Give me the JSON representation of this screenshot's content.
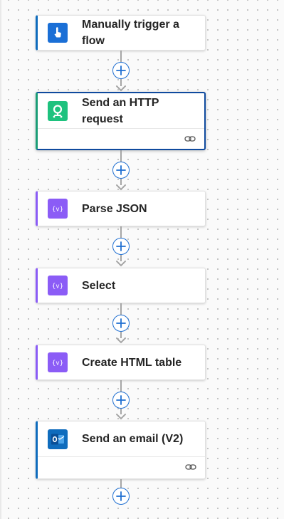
{
  "steps": [
    {
      "title": "Manually trigger a flow",
      "icon": "hand-touch-icon"
    },
    {
      "title": "Send an HTTP request",
      "icon": "http-connector-icon"
    },
    {
      "title": "Parse JSON",
      "icon": "data-operation-icon"
    },
    {
      "title": "Select",
      "icon": "data-operation-icon"
    },
    {
      "title": "Create HTML table",
      "icon": "data-operation-icon"
    },
    {
      "title": "Send an email (V2)",
      "icon": "outlook-icon"
    }
  ],
  "colors": {
    "trigger_accent": "#0f6cbd",
    "data_operation_accent": "#8b5cf6",
    "selected_border": "#0f4a9e",
    "http_icon_bg": "#1ec27e",
    "add_button": "#1f6fd1"
  }
}
